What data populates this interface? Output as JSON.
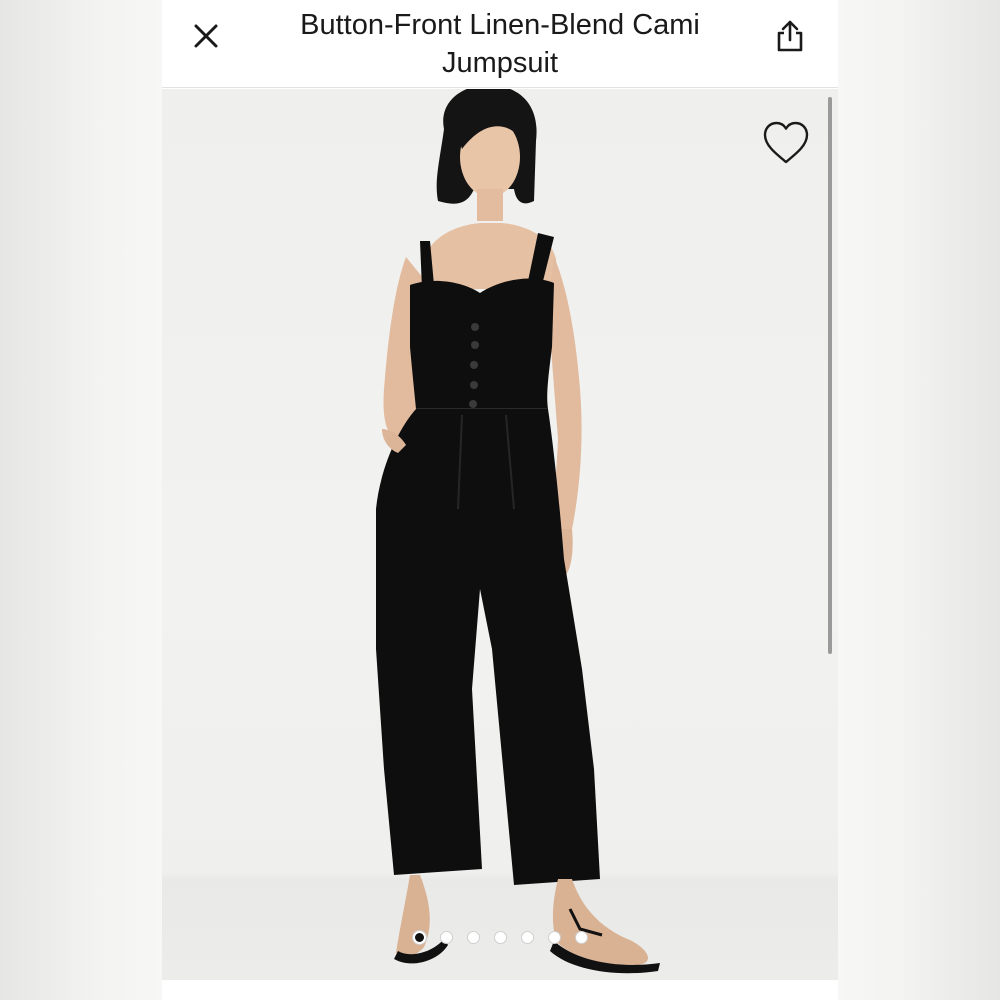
{
  "header": {
    "title": "Button-Front Linen-Blend Cami Jumpsuit",
    "close_icon": "close-icon",
    "share_icon": "share-icon"
  },
  "product_image": {
    "favorite_icon": "heart-outline-icon",
    "image_count": 7,
    "active_index": 0
  },
  "colors": {
    "jumpsuit": "#0e0e0e",
    "background": "#f1f1ef",
    "text": "#1a1a1a"
  }
}
